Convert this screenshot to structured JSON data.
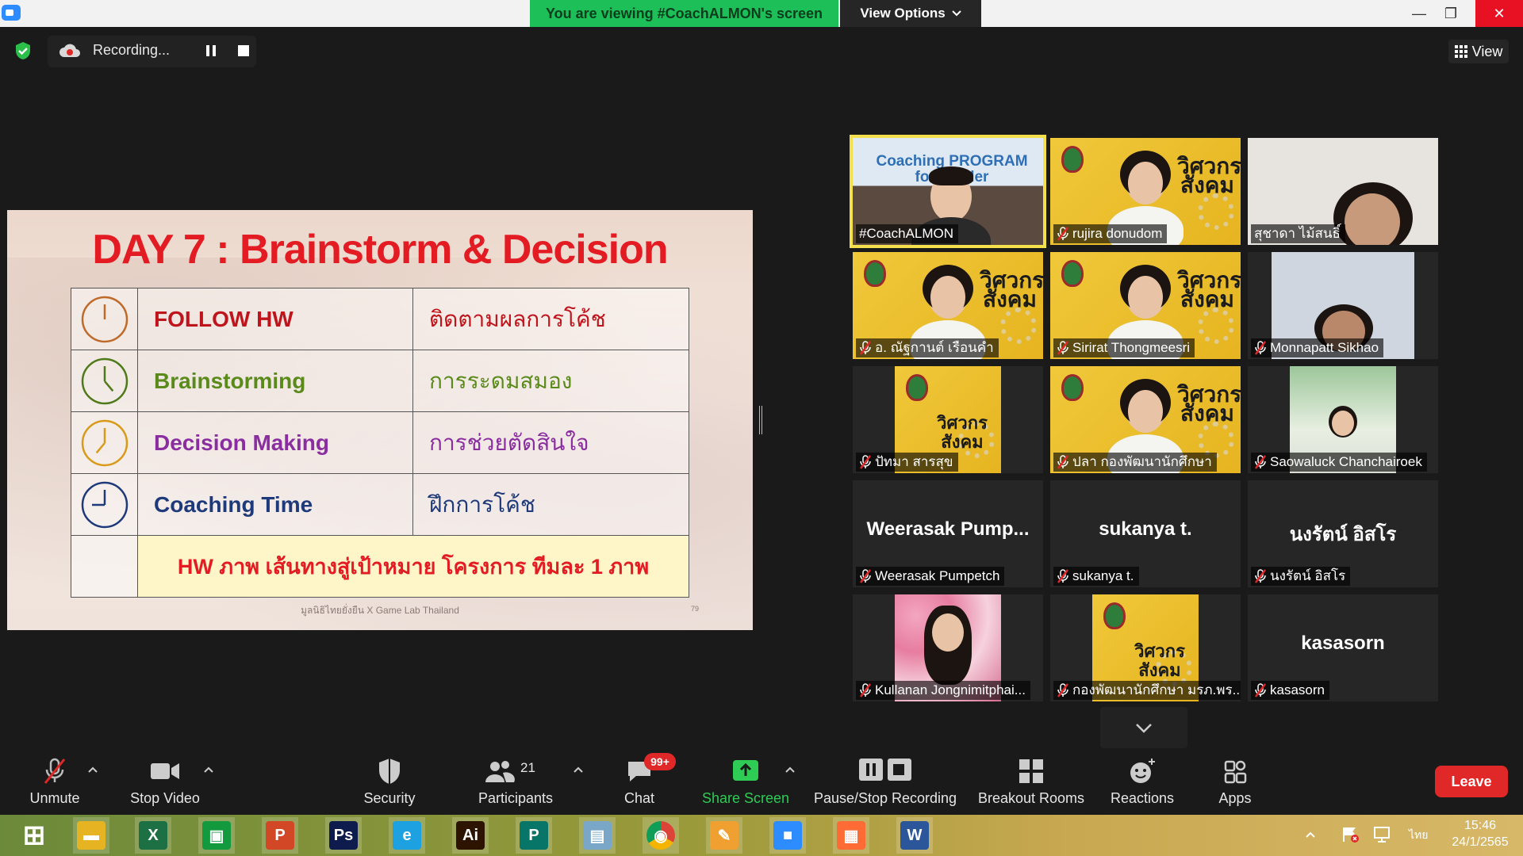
{
  "window": {
    "banner": "You are viewing #CoachALMON's screen",
    "view_options": "View Options",
    "minimize": "—",
    "restore": "❐",
    "close": "✕"
  },
  "recording": {
    "label": "Recording...",
    "view_button": "View"
  },
  "slide": {
    "title": "DAY 7 : Brainstorm & Decision",
    "rows": [
      {
        "en": "FOLLOW HW",
        "th": "ติดตามผลการโค้ช",
        "color": "#c0141c",
        "clock": "#c06a2a"
      },
      {
        "en": "Brainstorming",
        "th": "การระดมสมอง",
        "color": "#5a8a1a",
        "clock": "#4f7a1a"
      },
      {
        "en": "Decision Making",
        "th": "การช่วยตัดสินใจ",
        "color": "#8a2da0",
        "clock": "#d99a1a"
      },
      {
        "en": "Coaching Time",
        "th": "ฝึกการโค้ช",
        "color": "#1f3a7a",
        "clock": "#1f3a7a"
      }
    ],
    "homework": "HW ภาพ เส้นทางสู่เป้าหมาย โครงการ ทีมละ 1 ภาพ",
    "footer": "มูลนิธิไทยยั่งยืน X Game Lab Thailand",
    "page_number": "79"
  },
  "gallery": {
    "tiles": [
      {
        "name": "#CoachALMON",
        "muted": false,
        "active": true,
        "overlay": "Coaching PROGRAM for Leader"
      },
      {
        "name": "rujira donudom",
        "muted": true
      },
      {
        "name": "สุชาดา ไม้สนธิ์",
        "muted": false
      },
      {
        "name": "อ. ณัฐกานต์  เรือนคำ",
        "muted": true
      },
      {
        "name": "Sirirat Thongmeesri",
        "muted": true
      },
      {
        "name": "Monnapatt Sikhao",
        "muted": true
      },
      {
        "name": "ปัทมา สารสุข",
        "muted": true
      },
      {
        "name": "ปลา กองพัฒนานักศึกษา",
        "muted": true
      },
      {
        "name": "Saowaluck Chanchairoek",
        "muted": true
      },
      {
        "name": "Weerasak Pumpetch",
        "muted": true,
        "big": "Weerasak  Pump..."
      },
      {
        "name": "sukanya t.",
        "muted": true,
        "big": "sukanya t."
      },
      {
        "name": "นงรัตน์ อิสโร",
        "muted": true,
        "big": "นงรัตน์ อิสโร"
      },
      {
        "name": "Kullanan Jongnimitphai...",
        "muted": true
      },
      {
        "name": "กองพัฒนานักศึกษา มรภ.พร...",
        "muted": true
      },
      {
        "name": "kasasorn",
        "muted": true,
        "big": "kasasorn"
      }
    ],
    "yellow_logo_text": "วิศวกร สังคม"
  },
  "toolbar": {
    "unmute": "Unmute",
    "stop_video": "Stop Video",
    "security": "Security",
    "participants": "Participants",
    "participants_count": "21",
    "chat": "Chat",
    "chat_badge": "99+",
    "share_screen": "Share Screen",
    "pause_stop_recording": "Pause/Stop Recording",
    "breakout_rooms": "Breakout Rooms",
    "reactions": "Reactions",
    "apps": "Apps",
    "leave": "Leave"
  },
  "taskbar": {
    "apps": [
      "windows-start",
      "file-explorer",
      "excel",
      "store",
      "powerpoint",
      "photoshop",
      "internet-explorer",
      "illustrator",
      "publisher",
      "notepad",
      "chrome",
      "paint",
      "zoom",
      "photos",
      "word"
    ],
    "lang": "ไทย",
    "time": "15:46",
    "date": "24/1/2565"
  }
}
